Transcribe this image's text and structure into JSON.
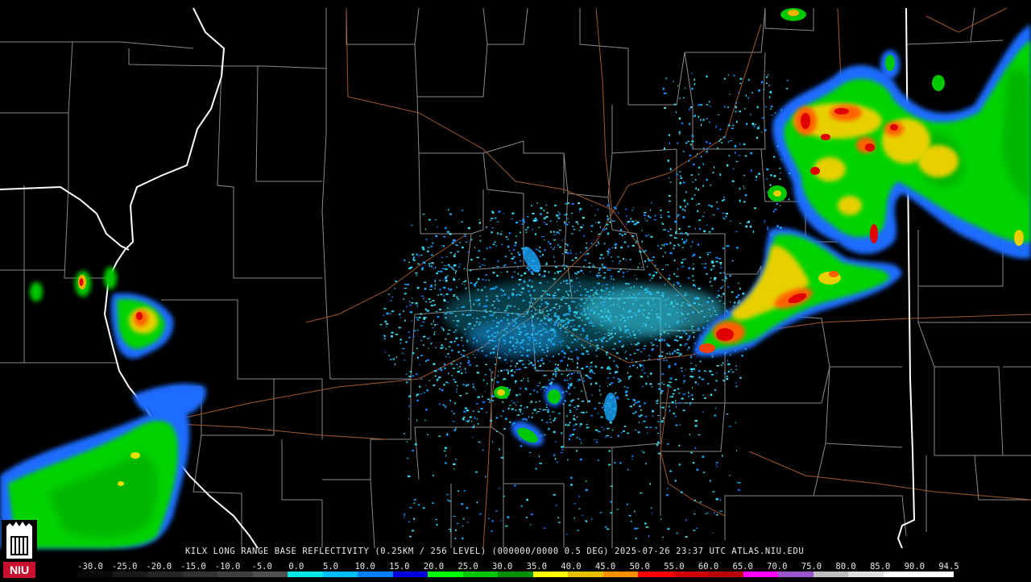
{
  "product": {
    "caption": "KILX LONG RANGE BASE REFLECTIVITY (0.25KM / 256 LEVEL) (000000/0000 0.5 DEG) 2025-07-26 23:37 UTC  ATLAS.NIU.EDU",
    "logo_text": "NIU"
  },
  "scale": {
    "labels": [
      "-30.0",
      "-25.0",
      "-20.0",
      "-15.0",
      "-10.0",
      "-5.0",
      "0.0",
      "5.0",
      "10.0",
      "15.0",
      "20.0",
      "25.0",
      "30.0",
      "35.0",
      "40.0",
      "45.0",
      "50.0",
      "55.0",
      "60.0",
      "65.0",
      "70.0",
      "75.0",
      "80.0",
      "85.0",
      "90.0",
      "94.5"
    ],
    "colors": [
      "#0a0a0a",
      "#1a1a1a",
      "#262626",
      "#333333",
      "#404040",
      "#505050",
      "#00e8e8",
      "#00bfff",
      "#0080ff",
      "#0000e0",
      "#00ff00",
      "#00c800",
      "#009000",
      "#ffff00",
      "#e8c000",
      "#ff9000",
      "#ff0000",
      "#d40000",
      "#bc0000",
      "#ff00ff",
      "#9955c9",
      "#c0c0c0",
      "#e0e0e0",
      "#ffffff",
      "#ffffff"
    ]
  },
  "icons": {
    "logo": "niu-castle-logo"
  }
}
